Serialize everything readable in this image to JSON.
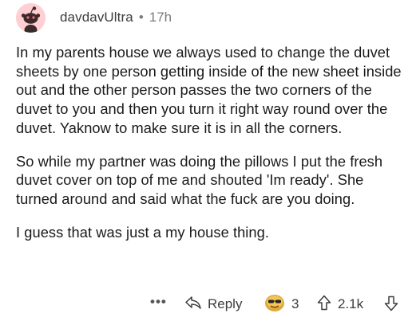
{
  "comment": {
    "username": "davdavUltra",
    "separator": "•",
    "time": "17h",
    "paragraphs": [
      "In my parents house we always used to change the duvet sheets by one person getting inside of the new sheet inside out and the other person passes the two corners of the duvet to you and then you turn it right way round over the duvet. Yaknow to make sure it is in all the corners.",
      "So while my partner was doing the pillows I put the fresh duvet cover on top of me and shouted 'Im ready'. She turned around and said what the fuck are you doing.",
      "I guess that was just a my house thing."
    ]
  },
  "actions": {
    "more": "•••",
    "reply_label": "Reply",
    "award_count": "3",
    "score": "2.1k"
  },
  "icons": {
    "avatar": "snoo-avatar-icon",
    "more": "more-options-icon",
    "reply": "reply-arrow-icon",
    "award": "award-icon",
    "upvote": "upvote-arrow-icon",
    "downvote": "downvote-arrow-icon"
  },
  "colors": {
    "avatar_bg": "#ffcfd3",
    "text": "#1a1a1a",
    "meta": "#7c7c7c"
  }
}
